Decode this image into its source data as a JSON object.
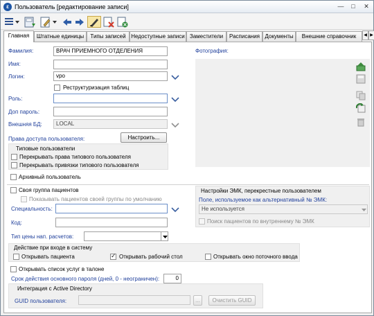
{
  "window": {
    "app_icon_glyph": "ε",
    "title": "Пользователь [редактирование записи]",
    "min": "—",
    "max": "□",
    "close": "✕"
  },
  "toolbar": {
    "icons": [
      "menu-dropdown-icon",
      "save-icon",
      "edit-icon",
      "back-arrow-icon",
      "forward-arrow-icon",
      "pencil-icon",
      "delete-icon",
      "close-record-icon"
    ]
  },
  "tabs": [
    {
      "label": "Главная",
      "active": true
    },
    {
      "label": "Штатные единицы"
    },
    {
      "label": "Типы записей"
    },
    {
      "label": "Недоступные записи"
    },
    {
      "label": "Заместители"
    },
    {
      "label": "Расписания"
    },
    {
      "label": "Документы"
    },
    {
      "label": "Внешние справочник"
    }
  ],
  "form": {
    "surname_label": "Фамилия:",
    "surname_value": "ВРАЧ ПРИЕМНОГО ОТДЕЛЕНИЯ",
    "name_label": "Имя:",
    "name_value": "",
    "login_label": "Логин:",
    "login_value": "vpo",
    "restructure_label": "Реструктуризация таблиц",
    "role_label": "Роль:",
    "role_value": "",
    "extra_password_label": "Доп пароль:",
    "external_db_label": "Внешняя БД:",
    "external_db_value": "LOCAL",
    "access_rights_label": "Права доступа пользователя:",
    "configure_button": "Настроить...",
    "typical_users_header": "Типовые пользователи",
    "override_rights_label": "Перекрывать права типового пользователя",
    "override_bindings_label": "Перекрывать привязки типового пользователя",
    "archive_user_label": "Архивный пользователь",
    "photo_label": "Фотография:"
  },
  "patients": {
    "own_group_label": "Своя группа пациентов",
    "show_default_label": "Показывать пациентов своей группы по умолчанию",
    "specialty_label": "Специальность:",
    "specialty_value": "",
    "code_label": "Код:",
    "code_value": "",
    "price_type_label": "Тип цены нап. расчетов:",
    "price_type_value": ""
  },
  "emk": {
    "header": "Настройки ЭМК, перекрестные пользователем",
    "field_label": "Поле, используемое как альтернативный № ЭМК:",
    "field_value": "Не используется",
    "search_internal_label": "Поиск пациентов по внутреннему № ЭМК"
  },
  "login_action": {
    "header": "Действие при входе в систему",
    "open_patient_label": "Открывать пациента",
    "open_desktop_label": "Открывать рабочий стол",
    "open_desktop_checked": true,
    "open_input_label": "Открывать окно поточного ввода"
  },
  "misc": {
    "open_services_label": "Открывать список услуг в талоне",
    "password_validity_label": "Срок действия основного пароля (дней, 0 - неограничен):",
    "password_validity_value": "0"
  },
  "ad": {
    "header": "Интеграция с Active Directory",
    "guid_label": "GUID пользователя:",
    "guid_value": "",
    "browse_button": "...",
    "clear_button": "Очистить GUID"
  },
  "colors": {
    "label_blue": "#1f3f9b",
    "group_bg": "#f0f0f0"
  }
}
